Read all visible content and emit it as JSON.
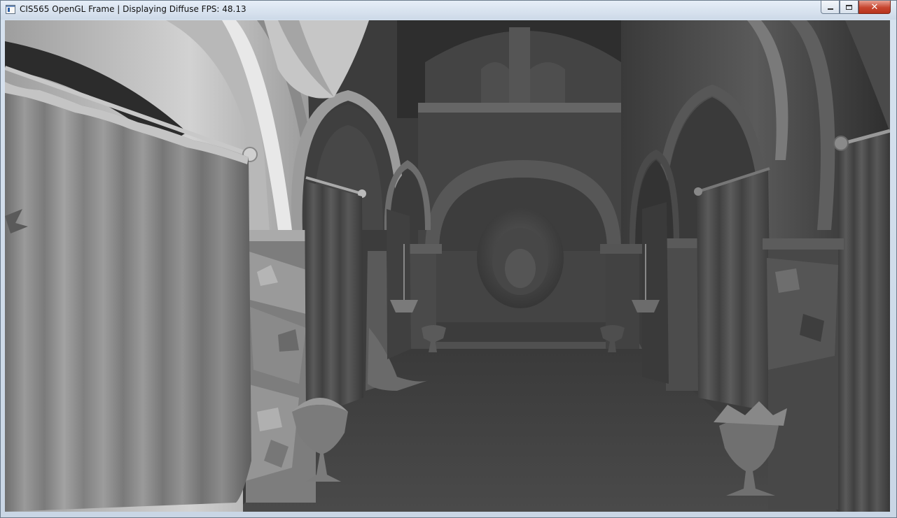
{
  "window": {
    "title": "CIS565 OpenGL Frame | Displaying Diffuse FPS: 48.13",
    "controls": {
      "minimize_icon": "minimize-icon",
      "maximize_icon": "maximize-icon",
      "close_glyph": "✕"
    }
  },
  "viewport": {
    "description_icon": "render-viewport",
    "scene": "sponza-atrium-diffuse-render"
  }
}
